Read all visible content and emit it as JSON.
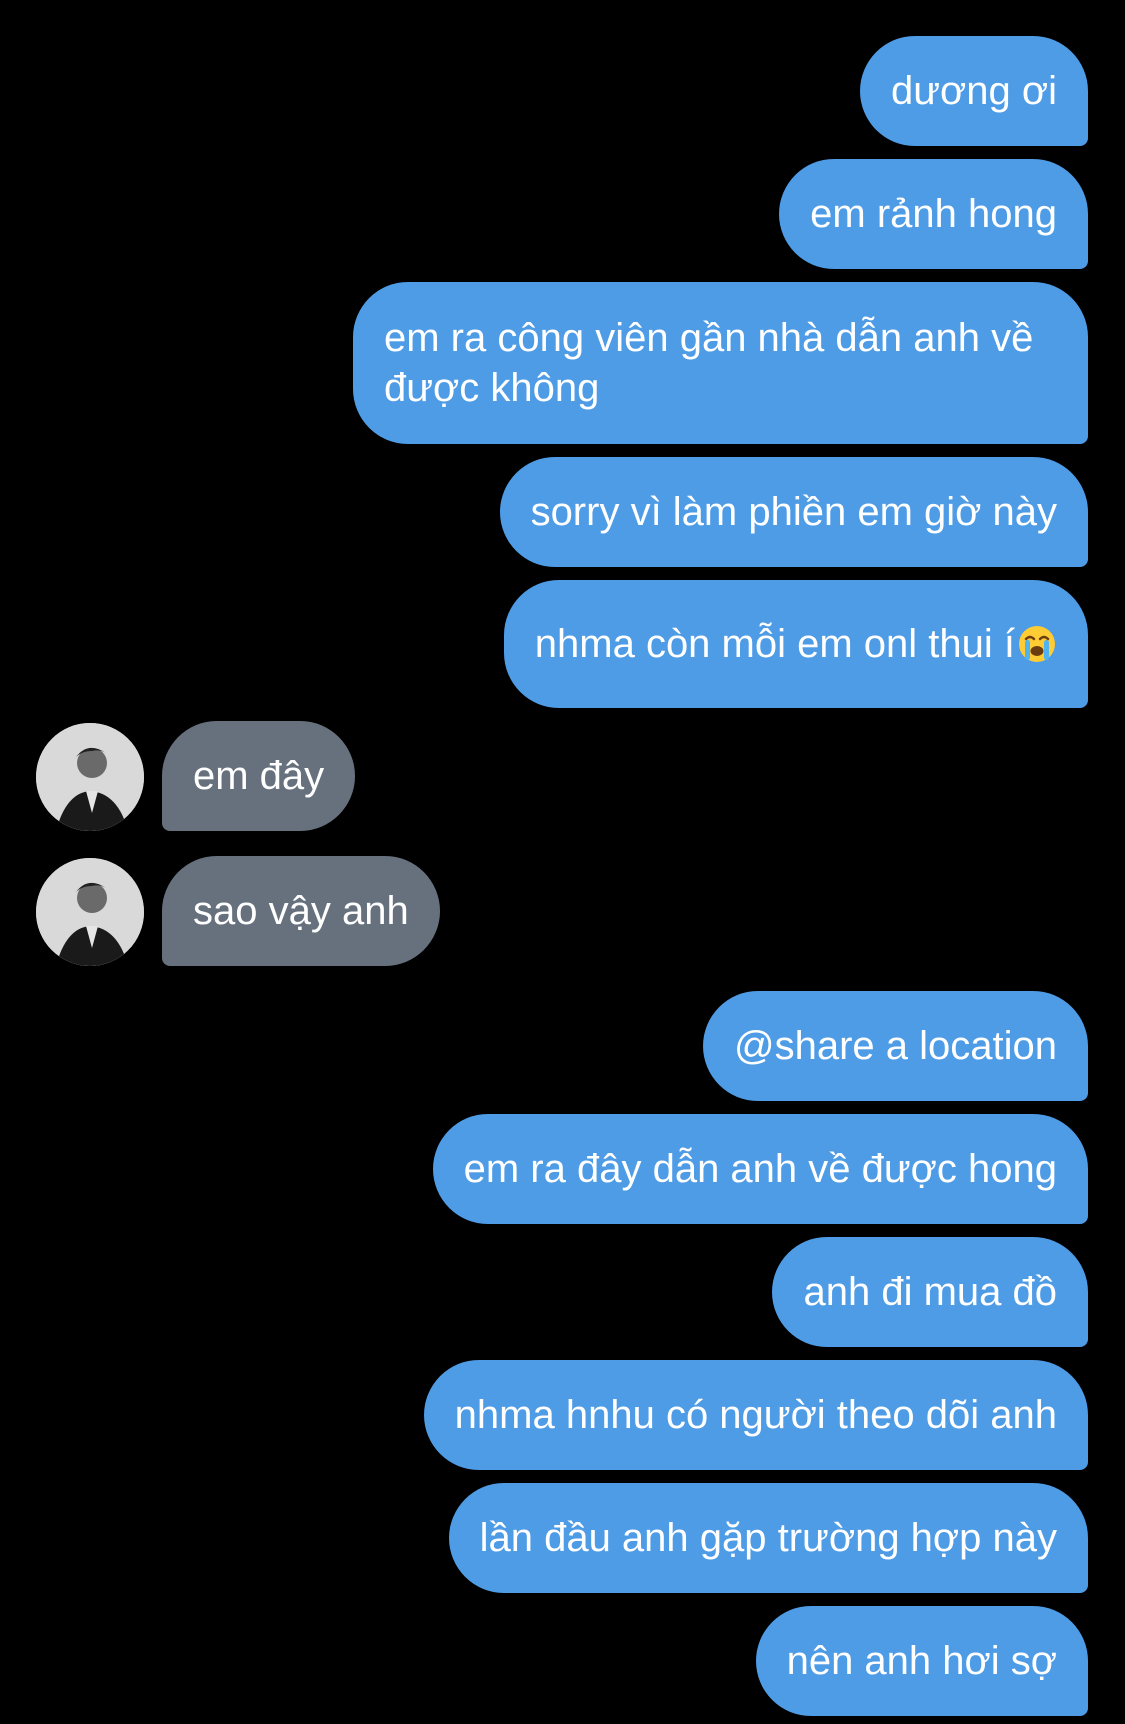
{
  "conversation": {
    "messages": [
      {
        "sender": "me",
        "text": "dương ơi"
      },
      {
        "sender": "me",
        "text": "em rảnh hong"
      },
      {
        "sender": "me",
        "text": "em ra công viên gần nhà dẫn anh về được không"
      },
      {
        "sender": "me",
        "text": "sorry vì làm phiền em giờ này"
      },
      {
        "sender": "me",
        "text": "nhma còn mỗi em onl thui í",
        "emoji": "loudly-crying-face-icon"
      },
      {
        "sender": "them",
        "text": "em đây"
      },
      {
        "sender": "them",
        "text": "sao vậy anh"
      },
      {
        "sender": "me",
        "text": "@share a location"
      },
      {
        "sender": "me",
        "text": "em ra đây dẫn anh về được hong"
      },
      {
        "sender": "me",
        "text": "anh đi mua đồ"
      },
      {
        "sender": "me",
        "text": "nhma hnhu có người theo dõi anh"
      },
      {
        "sender": "me",
        "text": "lần đầu anh gặp trường hợp này"
      },
      {
        "sender": "me",
        "text": "nên anh hơi sợ"
      }
    ]
  },
  "colors": {
    "background": "#000000",
    "sent_bubble": "#4e9be6",
    "received_bubble": "#67717e",
    "text": "#ffffff"
  }
}
